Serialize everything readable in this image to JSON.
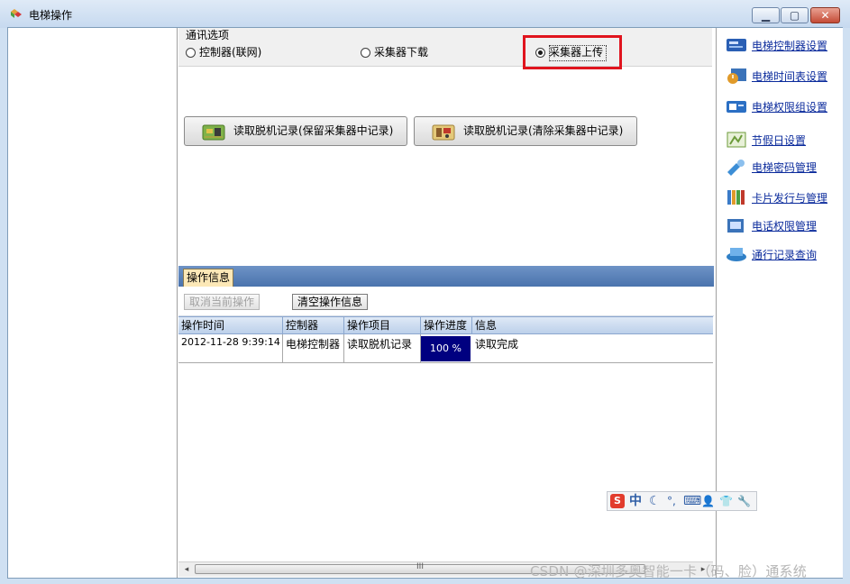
{
  "window": {
    "title": "电梯操作",
    "min_glyph": "▁",
    "max_glyph": "▢",
    "close_glyph": "✕"
  },
  "comm_options": {
    "title": "通讯选项",
    "radios": [
      {
        "label": "控制器(联网)",
        "selected": false
      },
      {
        "label": "采集器下载",
        "selected": false
      },
      {
        "label": "采集器上传",
        "selected": true
      }
    ]
  },
  "actions": {
    "read_keep": "读取脱机记录(保留采集器中记录)",
    "read_clear": "读取脱机记录(清除采集器中记录)"
  },
  "ops": {
    "tab_label": "操作信息",
    "cancel_label": "取消当前操作",
    "clear_label": "清空操作信息",
    "columns": [
      "操作时间",
      "控制器",
      "操作项目",
      "操作进度",
      "信息"
    ],
    "rows": [
      {
        "time": "2012-11-28 9:39:14",
        "controller": "电梯控制器",
        "item": "读取脱机记录",
        "progress": "100 %",
        "info": "读取完成"
      }
    ],
    "scroll_left": "◂",
    "scroll_right": "▸",
    "scroll_grip": "III"
  },
  "sidebar": {
    "items": [
      {
        "label": "电梯控制器设置",
        "icon": "controller-settings-icon",
        "color": "#2a5fb4"
      },
      {
        "label": "电梯时间表设置",
        "icon": "schedule-icon",
        "color": "#e09a2a"
      },
      {
        "label": "电梯权限组设置",
        "icon": "permission-group-icon",
        "color": "#2b6fc4"
      },
      {
        "label": "节假日设置",
        "icon": "holiday-icon",
        "color": "#6c9b3a"
      },
      {
        "label": "电梯密码管理",
        "icon": "password-icon",
        "color": "#3c8ed6"
      },
      {
        "label": "卡片发行与管理",
        "icon": "card-issue-icon",
        "color": "#3a7bc8"
      },
      {
        "label": "电话权限管理",
        "icon": "phone-permission-icon",
        "color": "#3b73b9"
      },
      {
        "label": "通行记录查询",
        "icon": "access-records-icon",
        "color": "#2f7fc6"
      }
    ]
  },
  "ime": {
    "logo": "S",
    "mode": "中",
    "half_width": "☾",
    "punct": "°,",
    "keyboard": "⌨",
    "user": "👤",
    "skin": "👕",
    "tools": "🔧"
  },
  "watermark": "CSDN @深圳多奥智能一卡（码、脸）通系统"
}
